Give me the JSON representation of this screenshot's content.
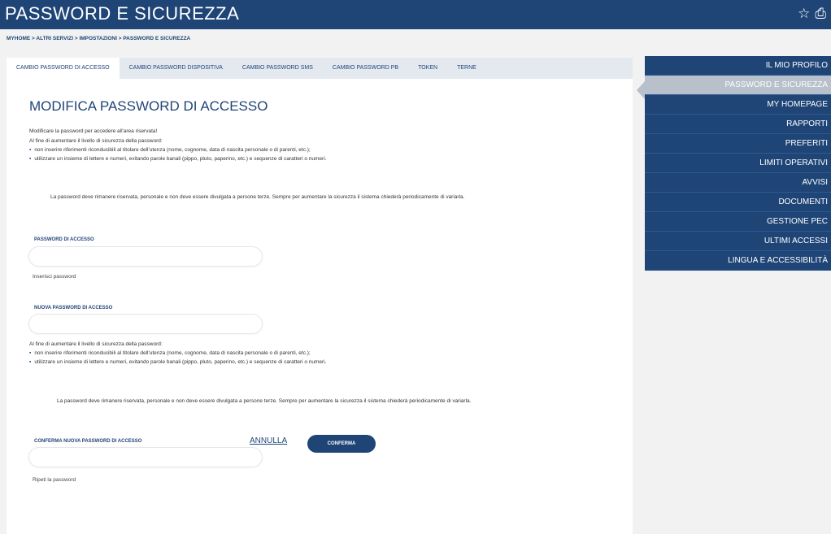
{
  "header": {
    "title": "PASSWORD E SICUREZZA",
    "icons": [
      {
        "name": "star-icon",
        "glyph": "☆"
      },
      {
        "name": "print-icon",
        "glyph": "⎙"
      }
    ]
  },
  "breadcrumb": "MYHOME > ALTRI SERVIZI > IMPOSTAZIONI > PASSWORD E SICUREZZA",
  "tabs": [
    {
      "label": "CAMBIO PASSWORD DI ACCESSO",
      "active": true
    },
    {
      "label": "CAMBIO PASSWORD DISPOSITIVA"
    },
    {
      "label": "CAMBIO PASSWORD SMS"
    },
    {
      "label": "CAMBIO PASSWORD PB"
    },
    {
      "label": "TOKEN"
    },
    {
      "label": "TERNE"
    }
  ],
  "main": {
    "heading": "MODIFICA PASSWORD DI ACCESSO",
    "intro1": "Modificare la password per accedere all'area riservata!",
    "intro2": "Al fine di aumentare il livello di sicurezza della password:",
    "bullet1": "non inserire riferimenti riconducibili al titolare dell'utenza (nome, cognome, data di nascita personale o di parenti, etc.);",
    "bullet2": "utilizzare un insieme di lettere e numeri, evitando parole banali (pippo, pluto, paperino, etc.) e sequenze di caratteri o numeri.",
    "note": "La password deve rimanere riservata, personale e non deve essere divulgata a persone terze. Sempre per aumentare la sicurezza il sistema chiederà periodicamente di variarla.",
    "field1": {
      "label": "PASSWORD DI ACCESSO",
      "hint": "Inserisci password",
      "value": ""
    },
    "field2": {
      "label": "NUOVA PASSWORD DI ACCESSO",
      "value": ""
    },
    "intro3": "Al fine di aumentare il livello di sicurezza della password:",
    "bullet3": "non inserire riferimenti riconducibili al titolare dell'utenza (nome, cognome, data di nascita personale o di parenti, etc.);",
    "bullet4": "utilizzare un insieme di lettere e numeri, evitando parole banali (pippo, pluto, paperino, etc.) e sequenze di caratteri o numeri.",
    "note2": "La password deve rimanere riservata, personale e non deve essere divulgata a persone terze. Sempre per aumentare la sicurezza il sistema chiederà periodicamente di variarla.",
    "field3": {
      "label": "CONFERMA NUOVA PASSWORD DI ACCESSO",
      "hint": "Ripeti la password",
      "value": ""
    },
    "cancel": "ANNULLA",
    "confirm": "CONFERMA"
  },
  "sidebar": [
    {
      "label": "IL MIO PROFILO"
    },
    {
      "label": "PASSWORD E SICUREZZA",
      "active": true
    },
    {
      "label": "MY HOMEPAGE"
    },
    {
      "label": "RAPPORTI"
    },
    {
      "label": "PREFERITI"
    },
    {
      "label": "LIMITI OPERATIVI"
    },
    {
      "label": "AVVISI"
    },
    {
      "label": "DOCUMENTI"
    },
    {
      "label": "GESTIONE PEC"
    },
    {
      "label": "ULTIMI ACCESSI"
    },
    {
      "label": "LINGUA E ACCESSIBILITÀ"
    }
  ],
  "colors": {
    "brand": "#1f4577",
    "active_side": "#b7c0cb"
  }
}
